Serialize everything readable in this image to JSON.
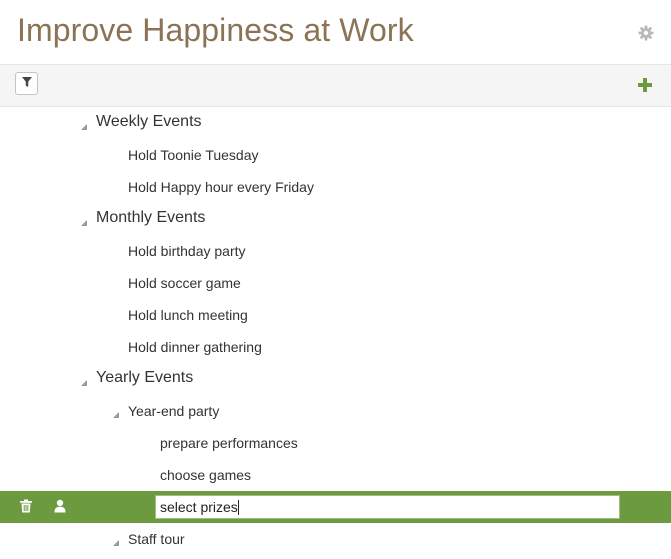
{
  "header": {
    "title": "Improve Happiness at Work",
    "settings_icon": "gear-icon"
  },
  "toolbar": {
    "filter_icon": "filter-icon",
    "add_icon": "plus-icon",
    "accent_color": "#6b9b3e"
  },
  "tree": {
    "items": [
      {
        "label": "Weekly Events",
        "level": 1,
        "expanded": true
      },
      {
        "label": "Hold Toonie Tuesday",
        "level": 2
      },
      {
        "label": "Hold Happy hour every Friday",
        "level": 2
      },
      {
        "label": "Monthly Events",
        "level": 1,
        "expanded": true
      },
      {
        "label": "Hold birthday party",
        "level": 2
      },
      {
        "label": "Hold soccer game",
        "level": 2
      },
      {
        "label": "Hold lunch meeting",
        "level": 2
      },
      {
        "label": "Hold dinner gathering",
        "level": 2
      },
      {
        "label": "Yearly Events",
        "level": 1,
        "expanded": true
      },
      {
        "label": "Year-end party",
        "level": 2,
        "expanded": true
      },
      {
        "label": "prepare performances",
        "level": 3
      },
      {
        "label": "choose games",
        "level": 3
      },
      {
        "label": "select prizes",
        "level": 3,
        "selected": true,
        "editing": true
      },
      {
        "label": "Staff tour",
        "level": 2,
        "expanded": true
      }
    ],
    "selected_row": {
      "delete_icon": "trash-icon",
      "assign_icon": "person-icon",
      "edit_value": "select prizes"
    }
  }
}
